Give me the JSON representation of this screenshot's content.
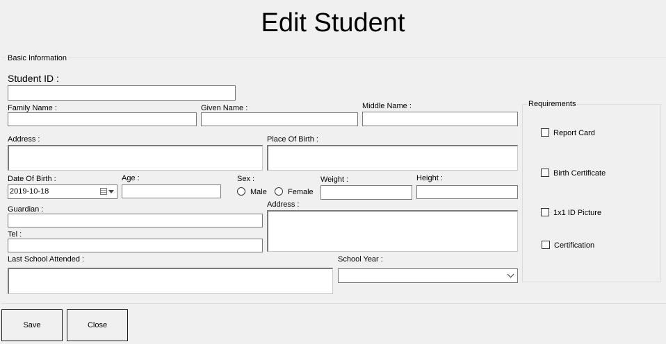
{
  "window": {
    "title": "Edit Student"
  },
  "basic_info": {
    "group_label": "Basic Information",
    "student_id_label": "Student ID :",
    "family_name_label": "Family Name :",
    "given_name_label": "Given Name :",
    "middle_name_label": "Middle Name :",
    "address_label": "Address :",
    "place_of_birth_label": "Place Of Birth :",
    "date_of_birth_label": "Date Of Birth :",
    "date_of_birth_value": "2019-10-18",
    "age_label": "Age :",
    "sex_label": "Sex :",
    "male_label": "Male",
    "female_label": "Female",
    "weight_label": "Weight :",
    "height_label": "Height :",
    "guardian_label": "Guardian :",
    "guardian_address_label": "Address :",
    "tel_label": "Tel :",
    "last_school_label": "Last School Attended :",
    "school_year_label": "School Year :"
  },
  "requirements": {
    "group_label": "Requirements",
    "items": [
      "Report Card",
      "Birth Certificate",
      "1x1 ID Picture",
      "Certification"
    ]
  },
  "buttons": {
    "save": "Save",
    "close": "Close"
  }
}
